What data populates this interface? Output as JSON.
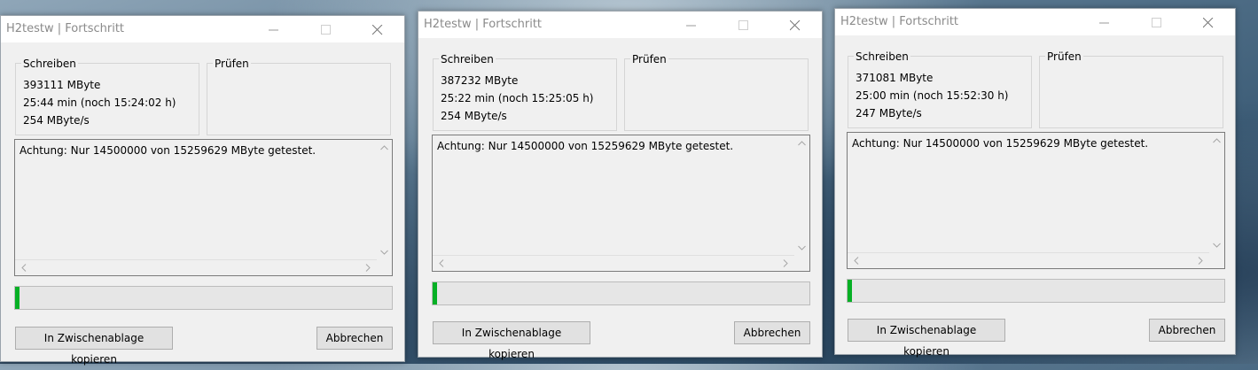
{
  "windows": [
    {
      "title": "H2testw | Fortschritt",
      "write_label": "Schreiben",
      "verify_label": "Prüfen",
      "written": "393111 MByte",
      "time": "25:44 min (noch 15:24:02 h)",
      "speed": "254 MByte/s",
      "log": "Achtung: Nur 14500000 von 15259629 MByte getestet.",
      "progress_percent": 1,
      "copy_button": "In Zwischenablage kopieren",
      "cancel_button": "Abbrechen"
    },
    {
      "title": "H2testw | Fortschritt",
      "write_label": "Schreiben",
      "verify_label": "Prüfen",
      "written": "387232 MByte",
      "time": "25:22 min (noch 15:25:05 h)",
      "speed": "254 MByte/s",
      "log": "Achtung: Nur 14500000 von 15259629 MByte getestet.",
      "progress_percent": 1,
      "copy_button": "In Zwischenablage kopieren",
      "cancel_button": "Abbrechen"
    },
    {
      "title": "H2testw | Fortschritt",
      "write_label": "Schreiben",
      "verify_label": "Prüfen",
      "written": "371081 MByte",
      "time": "25:00 min (noch 15:52:30 h)",
      "speed": "247 MByte/s",
      "log": "Achtung: Nur 14500000 von 15259629 MByte getestet.",
      "progress_percent": 1,
      "copy_button": "In Zwischenablage kopieren",
      "cancel_button": "Abbrechen"
    }
  ],
  "colors": {
    "progress_fill": "#06b025",
    "title_text": "#8a8a8a"
  }
}
